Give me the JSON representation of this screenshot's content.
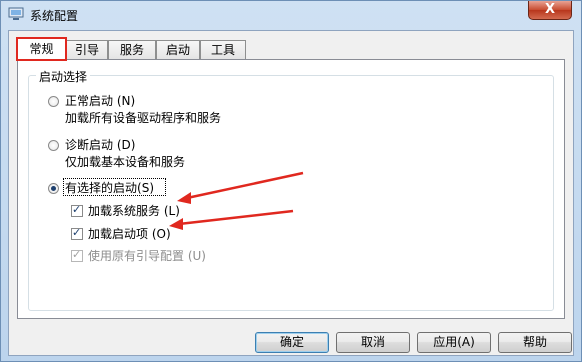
{
  "window": {
    "title": "系统配置",
    "close_label": "X"
  },
  "tabs": [
    {
      "label": "常规",
      "active": true
    },
    {
      "label": "引导",
      "active": false
    },
    {
      "label": "服务",
      "active": false
    },
    {
      "label": "启动",
      "active": false
    },
    {
      "label": "工具",
      "active": false
    }
  ],
  "startup_group": {
    "title": "启动选择",
    "options": [
      {
        "label": "正常启动",
        "hotkey": "(N)",
        "description": "加载所有设备驱动程序和服务",
        "selected": false
      },
      {
        "label": "诊断启动",
        "hotkey": "(D)",
        "description": "仅加载基本设备和服务",
        "selected": false
      },
      {
        "label": "有选择的启动",
        "hotkey": "(S)",
        "selected": true
      }
    ],
    "checkboxes": [
      {
        "label": "加载系统服务",
        "hotkey": "(L)",
        "checked": true,
        "enabled": true
      },
      {
        "label": "加载启动项",
        "hotkey": "(O)",
        "checked": true,
        "enabled": true
      },
      {
        "label": "使用原有引导配置",
        "hotkey": "(U)",
        "checked": true,
        "enabled": false
      }
    ]
  },
  "buttons": {
    "ok": "确定",
    "cancel": "取消",
    "apply": "应用",
    "apply_hotkey": "(A)",
    "help": "帮助"
  },
  "colors": {
    "annotation_arrow": "#e0281f",
    "tab_highlight": "#e0281f"
  }
}
